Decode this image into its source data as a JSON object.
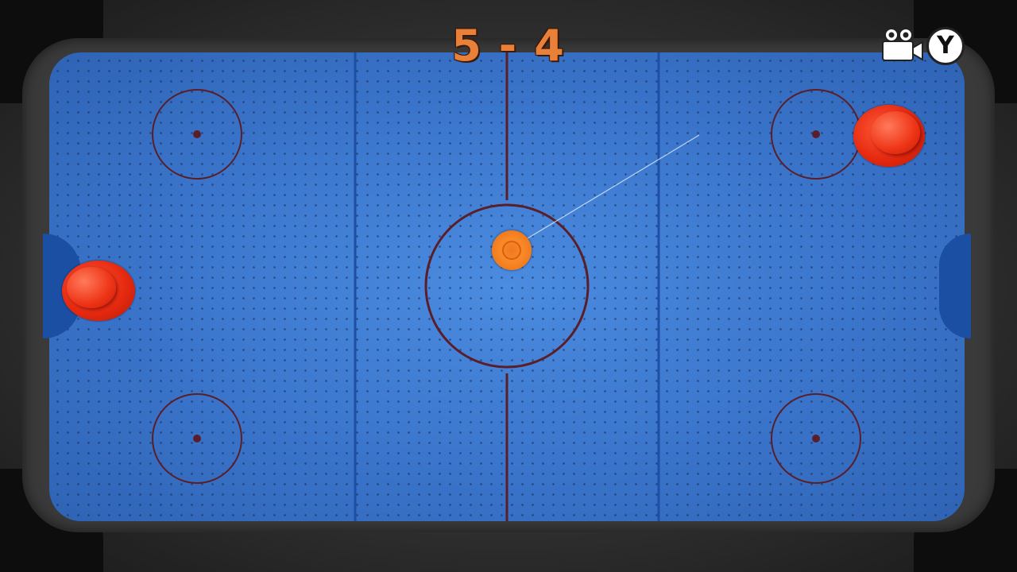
{
  "hud": {
    "score_left": "5",
    "score_separator": "-",
    "score_right": "4",
    "camera_icon": "video-camera-icon",
    "camera_button_label": "Y"
  },
  "colors": {
    "table_surface": "#3d7ad0",
    "lines": "#5a1e28",
    "blue_lines": "#1e4fa6",
    "goal": "#1b4fa3",
    "mallet": "#e62a10",
    "puck": "#f27a1c",
    "score_text": "#e8803a"
  },
  "game_objects": {
    "left_mallet": "red-mallet",
    "right_mallet": "red-mallet",
    "puck": "orange-puck",
    "aim_line": "trajectory-line"
  }
}
